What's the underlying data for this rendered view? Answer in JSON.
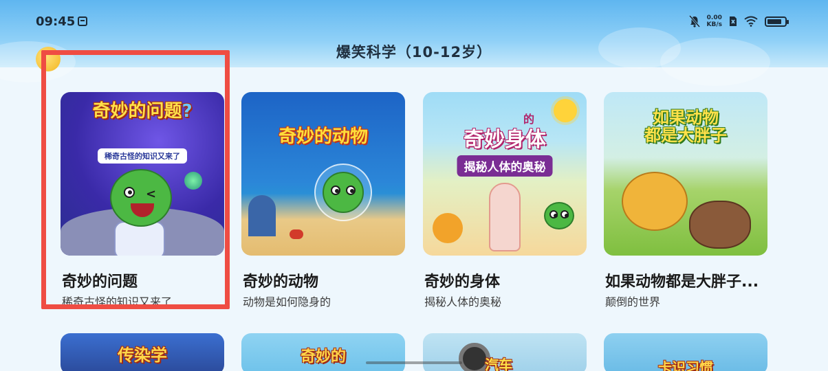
{
  "status_bar": {
    "time": "09:45",
    "netspeed_value": "0.00",
    "netspeed_unit": "KB/s",
    "battery_level": 0.82
  },
  "header": {
    "title": "爆笑科学（10-12岁）"
  },
  "cards": [
    {
      "title": "奇妙的问题",
      "subtitle": "稀奇古怪的知识又来了",
      "art_logo": "奇妙的问题",
      "art_logo_mark": "?",
      "art_banner": "稀奇古怪的知识又来了"
    },
    {
      "title": "奇妙的动物",
      "subtitle": "动物是如何隐身的",
      "art_logo": "奇妙的动物"
    },
    {
      "title": "奇妙的身体",
      "subtitle": "揭秘人体的奥秘",
      "art_logo": "奇妙身体",
      "art_logo_small": "的",
      "art_banner": "揭秘人体的奥秘"
    },
    {
      "title": "如果动物都是大胖子...",
      "subtitle": "颠倒的世界",
      "art_logo": "如果动物",
      "art_logo_line2": "都是大胖子"
    }
  ],
  "row2_art": [
    "传染学",
    "奇妙的",
    "汽车",
    "卡识习惯"
  ],
  "colors": {
    "highlight": "#ef4d43",
    "header_top": "#5fb6f0",
    "background": "#eef7fd"
  }
}
